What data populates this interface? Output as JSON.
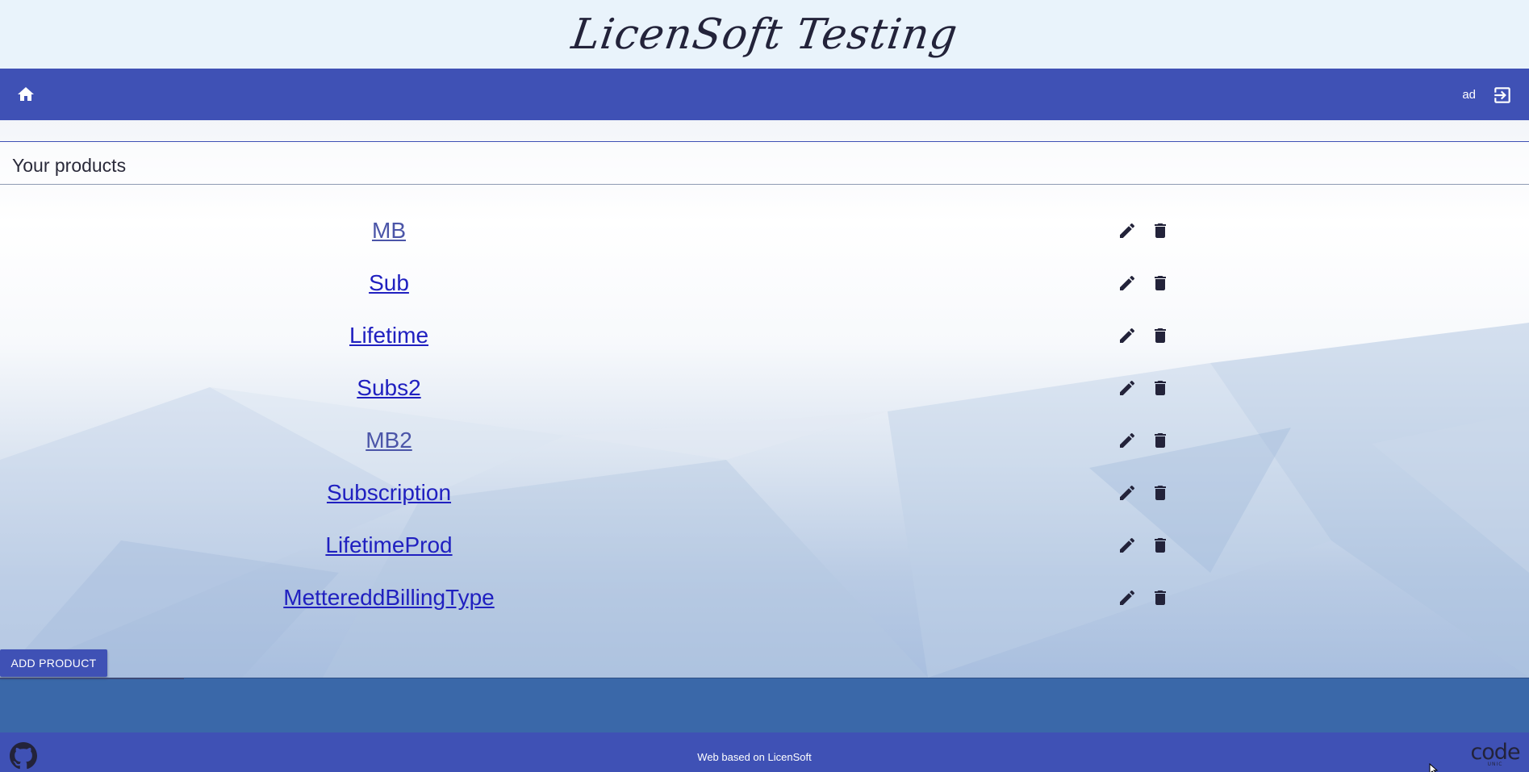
{
  "header": {
    "brand": "LicenSoft Testing"
  },
  "navbar": {
    "home_icon": "home-icon",
    "user_label": "ad",
    "logout_icon": "logout-icon"
  },
  "panel": {
    "title": "Your products"
  },
  "products": [
    {
      "name": "MB",
      "visited": true
    },
    {
      "name": "Sub",
      "visited": false
    },
    {
      "name": "Lifetime",
      "visited": false
    },
    {
      "name": "Subs2",
      "visited": false
    },
    {
      "name": "MB2",
      "visited": true
    },
    {
      "name": "Subscription",
      "visited": false
    },
    {
      "name": "LifetimeProd",
      "visited": false
    },
    {
      "name": "MettereddBillingType",
      "visited": false
    }
  ],
  "row_actions": {
    "edit_icon": "pencil-icon",
    "delete_icon": "trash-icon"
  },
  "add_button": {
    "label": "ADD PRODUCT"
  },
  "footer": {
    "text_prefix": "Web based on ",
    "link_text": "LicenSoft",
    "github_icon": "github-icon",
    "logo_main": "code",
    "logo_sub": "UNIC"
  },
  "colors": {
    "primary": "#3f51b5",
    "header_bg": "#e9f3fb",
    "link": "#2020c0",
    "link_visited": "#4b55a8",
    "band": "#3a68a9"
  }
}
